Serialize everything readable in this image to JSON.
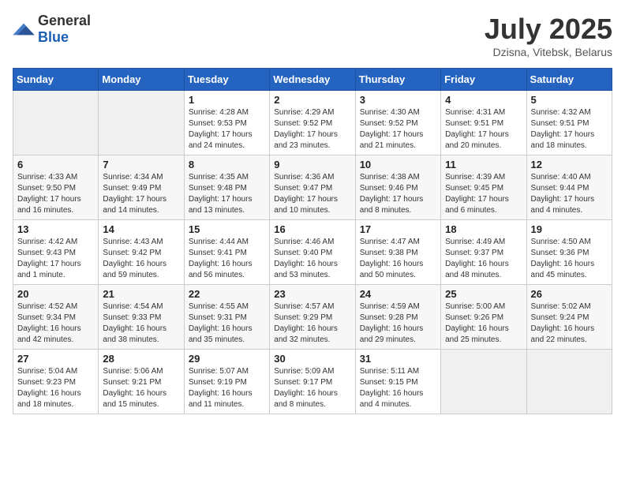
{
  "header": {
    "logo": {
      "general": "General",
      "blue": "Blue"
    },
    "title": "July 2025",
    "subtitle": "Dzisna, Vitebsk, Belarus"
  },
  "weekdays": [
    "Sunday",
    "Monday",
    "Tuesday",
    "Wednesday",
    "Thursday",
    "Friday",
    "Saturday"
  ],
  "weeks": [
    [
      {
        "day": "",
        "info": ""
      },
      {
        "day": "",
        "info": ""
      },
      {
        "day": "1",
        "info": "Sunrise: 4:28 AM\nSunset: 9:53 PM\nDaylight: 17 hours and 24 minutes."
      },
      {
        "day": "2",
        "info": "Sunrise: 4:29 AM\nSunset: 9:52 PM\nDaylight: 17 hours and 23 minutes."
      },
      {
        "day": "3",
        "info": "Sunrise: 4:30 AM\nSunset: 9:52 PM\nDaylight: 17 hours and 21 minutes."
      },
      {
        "day": "4",
        "info": "Sunrise: 4:31 AM\nSunset: 9:51 PM\nDaylight: 17 hours and 20 minutes."
      },
      {
        "day": "5",
        "info": "Sunrise: 4:32 AM\nSunset: 9:51 PM\nDaylight: 17 hours and 18 minutes."
      }
    ],
    [
      {
        "day": "6",
        "info": "Sunrise: 4:33 AM\nSunset: 9:50 PM\nDaylight: 17 hours and 16 minutes."
      },
      {
        "day": "7",
        "info": "Sunrise: 4:34 AM\nSunset: 9:49 PM\nDaylight: 17 hours and 14 minutes."
      },
      {
        "day": "8",
        "info": "Sunrise: 4:35 AM\nSunset: 9:48 PM\nDaylight: 17 hours and 13 minutes."
      },
      {
        "day": "9",
        "info": "Sunrise: 4:36 AM\nSunset: 9:47 PM\nDaylight: 17 hours and 10 minutes."
      },
      {
        "day": "10",
        "info": "Sunrise: 4:38 AM\nSunset: 9:46 PM\nDaylight: 17 hours and 8 minutes."
      },
      {
        "day": "11",
        "info": "Sunrise: 4:39 AM\nSunset: 9:45 PM\nDaylight: 17 hours and 6 minutes."
      },
      {
        "day": "12",
        "info": "Sunrise: 4:40 AM\nSunset: 9:44 PM\nDaylight: 17 hours and 4 minutes."
      }
    ],
    [
      {
        "day": "13",
        "info": "Sunrise: 4:42 AM\nSunset: 9:43 PM\nDaylight: 17 hours and 1 minute."
      },
      {
        "day": "14",
        "info": "Sunrise: 4:43 AM\nSunset: 9:42 PM\nDaylight: 16 hours and 59 minutes."
      },
      {
        "day": "15",
        "info": "Sunrise: 4:44 AM\nSunset: 9:41 PM\nDaylight: 16 hours and 56 minutes."
      },
      {
        "day": "16",
        "info": "Sunrise: 4:46 AM\nSunset: 9:40 PM\nDaylight: 16 hours and 53 minutes."
      },
      {
        "day": "17",
        "info": "Sunrise: 4:47 AM\nSunset: 9:38 PM\nDaylight: 16 hours and 50 minutes."
      },
      {
        "day": "18",
        "info": "Sunrise: 4:49 AM\nSunset: 9:37 PM\nDaylight: 16 hours and 48 minutes."
      },
      {
        "day": "19",
        "info": "Sunrise: 4:50 AM\nSunset: 9:36 PM\nDaylight: 16 hours and 45 minutes."
      }
    ],
    [
      {
        "day": "20",
        "info": "Sunrise: 4:52 AM\nSunset: 9:34 PM\nDaylight: 16 hours and 42 minutes."
      },
      {
        "day": "21",
        "info": "Sunrise: 4:54 AM\nSunset: 9:33 PM\nDaylight: 16 hours and 38 minutes."
      },
      {
        "day": "22",
        "info": "Sunrise: 4:55 AM\nSunset: 9:31 PM\nDaylight: 16 hours and 35 minutes."
      },
      {
        "day": "23",
        "info": "Sunrise: 4:57 AM\nSunset: 9:29 PM\nDaylight: 16 hours and 32 minutes."
      },
      {
        "day": "24",
        "info": "Sunrise: 4:59 AM\nSunset: 9:28 PM\nDaylight: 16 hours and 29 minutes."
      },
      {
        "day": "25",
        "info": "Sunrise: 5:00 AM\nSunset: 9:26 PM\nDaylight: 16 hours and 25 minutes."
      },
      {
        "day": "26",
        "info": "Sunrise: 5:02 AM\nSunset: 9:24 PM\nDaylight: 16 hours and 22 minutes."
      }
    ],
    [
      {
        "day": "27",
        "info": "Sunrise: 5:04 AM\nSunset: 9:23 PM\nDaylight: 16 hours and 18 minutes."
      },
      {
        "day": "28",
        "info": "Sunrise: 5:06 AM\nSunset: 9:21 PM\nDaylight: 16 hours and 15 minutes."
      },
      {
        "day": "29",
        "info": "Sunrise: 5:07 AM\nSunset: 9:19 PM\nDaylight: 16 hours and 11 minutes."
      },
      {
        "day": "30",
        "info": "Sunrise: 5:09 AM\nSunset: 9:17 PM\nDaylight: 16 hours and 8 minutes."
      },
      {
        "day": "31",
        "info": "Sunrise: 5:11 AM\nSunset: 9:15 PM\nDaylight: 16 hours and 4 minutes."
      },
      {
        "day": "",
        "info": ""
      },
      {
        "day": "",
        "info": ""
      }
    ]
  ]
}
